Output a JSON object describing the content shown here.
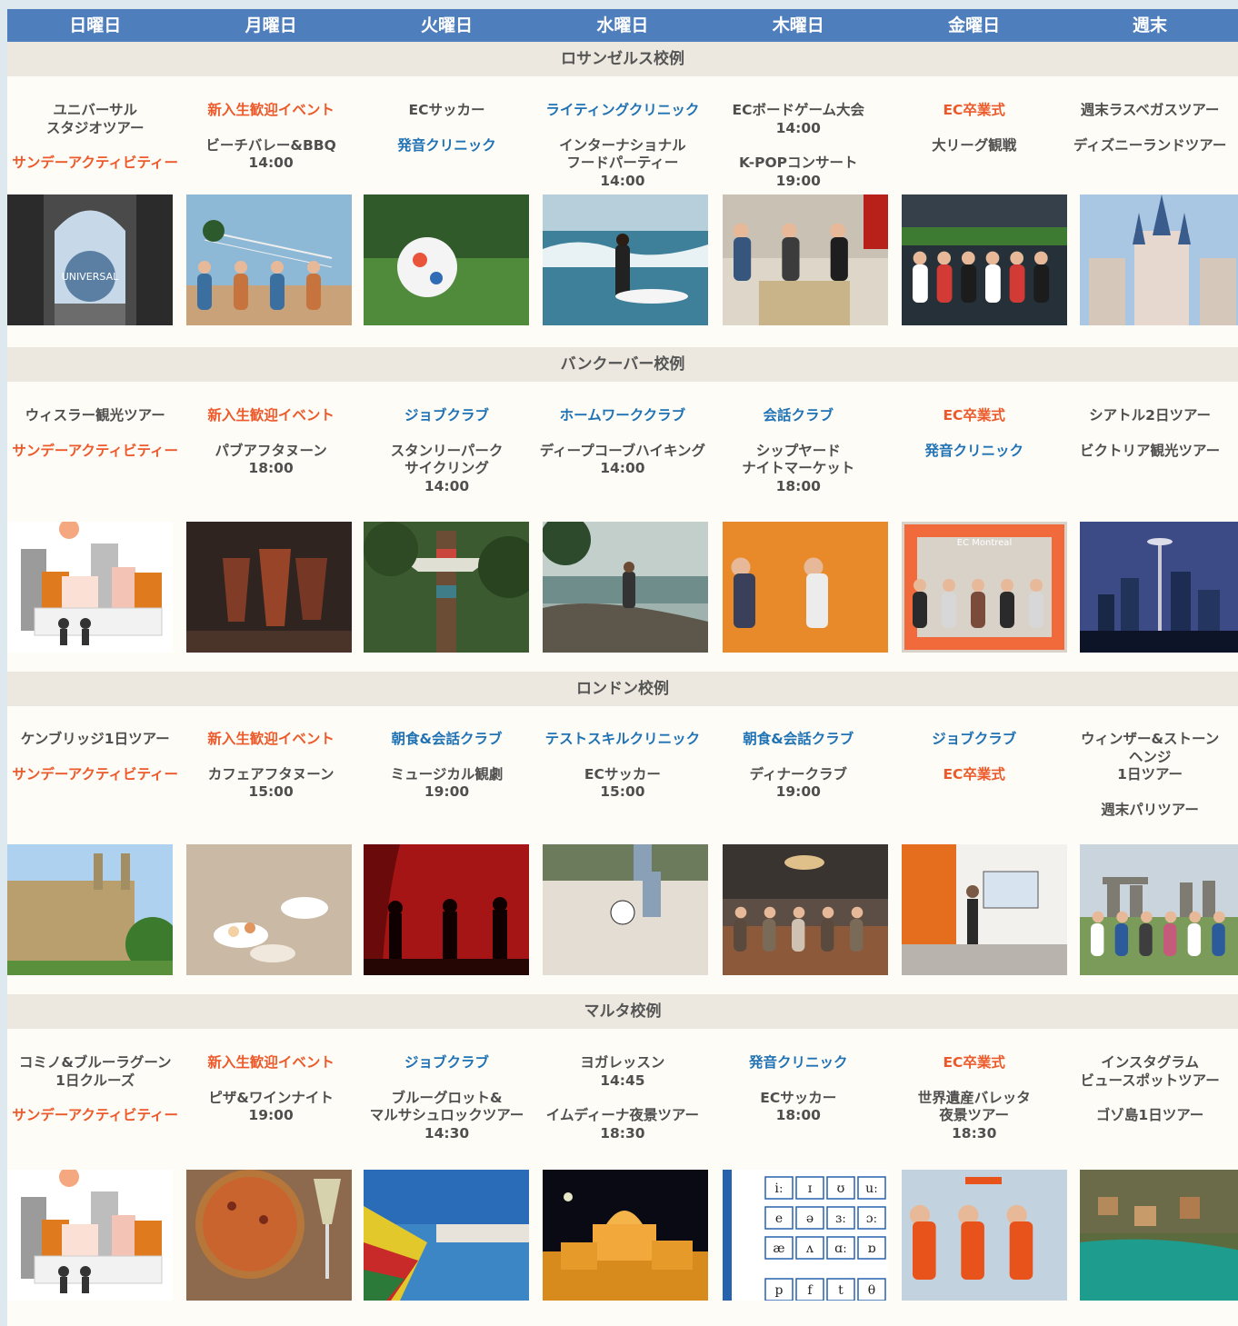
{
  "days": [
    "日曜日",
    "月曜日",
    "火曜日",
    "水曜日",
    "木曜日",
    "金曜日",
    "週末"
  ],
  "campuses": [
    {
      "name": "ロサンゼルス校例",
      "events": [
        [
          {
            "t": "ユニバーサル\nスタジオツアー",
            "c": "n"
          },
          {
            "t": "サンデーアクティビティー",
            "c": "o"
          }
        ],
        [
          {
            "t": "新入生歓迎イベント",
            "c": "o"
          },
          {
            "t": "ビーチバレー&BBQ\n14:00",
            "c": "n"
          }
        ],
        [
          {
            "t": "ECサッカー",
            "c": "n"
          },
          {
            "t": "発音クリニック",
            "c": "b"
          }
        ],
        [
          {
            "t": "ライティングクリニック",
            "c": "b"
          },
          {
            "t": "インターナショナル\nフードパーティー\n14:00",
            "c": "n"
          }
        ],
        [
          {
            "t": "ECボードゲーム大会\n14:00",
            "c": "n"
          },
          {
            "t": "K-POPコンサート\n19:00",
            "c": "n"
          }
        ],
        [
          {
            "t": "EC卒業式",
            "c": "o"
          },
          {
            "t": "大リーグ観戦",
            "c": "n"
          }
        ],
        [
          {
            "t": "週末ラスベガスツアー",
            "c": "n"
          },
          {
            "t": "ディズニーランドツアー",
            "c": "n"
          }
        ]
      ],
      "photos": [
        "Universal Studios archway",
        "Beach volleyball",
        "Soccer ball on grass",
        "Surfer in waves",
        "Board game party",
        "Baseball stadium crowd",
        "Disney castle"
      ]
    },
    {
      "name": "バンクーバー校例",
      "events": [
        [
          {
            "t": "ウィスラー観光ツアー",
            "c": "n"
          },
          {
            "t": "サンデーアクティビティー",
            "c": "o"
          }
        ],
        [
          {
            "t": "新入生歓迎イベント",
            "c": "o"
          },
          {
            "t": "パブアフタヌーン\n18:00",
            "c": "n"
          }
        ],
        [
          {
            "t": "ジョブクラブ",
            "c": "b"
          },
          {
            "t": "スタンリーパーク\nサイクリング\n14:00",
            "c": "n"
          }
        ],
        [
          {
            "t": "ホームワーククラブ",
            "c": "b"
          },
          {
            "t": "ディープコーブハイキング\n14:00",
            "c": "n"
          }
        ],
        [
          {
            "t": "会話クラブ",
            "c": "b"
          },
          {
            "t": "シップヤード\nナイトマーケット\n18:00",
            "c": "n"
          }
        ],
        [
          {
            "t": "EC卒業式",
            "c": "o"
          },
          {
            "t": "発音クリニック",
            "c": "b"
          }
        ],
        [
          {
            "t": "シアトル2日ツアー",
            "c": "n"
          },
          {
            "t": "ビクトリア観光ツアー",
            "c": "n"
          }
        ]
      ],
      "photos": [
        "City illustration",
        "Beer glasses toast",
        "Totem pole",
        "Coastal hiking",
        "Two students smiling",
        "EC Montreal frame",
        "Seattle skyline at night"
      ]
    },
    {
      "name": "ロンドン校例",
      "events": [
        [
          {
            "t": "ケンブリッジ1日ツアー",
            "c": "n"
          },
          {
            "t": "サンデーアクティビティー",
            "c": "o"
          }
        ],
        [
          {
            "t": "新入生歓迎イベント",
            "c": "o"
          },
          {
            "t": "カフェアフタヌーン\n15:00",
            "c": "n"
          }
        ],
        [
          {
            "t": "朝食&会話クラブ",
            "c": "b"
          },
          {
            "t": "ミュージカル観劇\n19:00",
            "c": "n"
          }
        ],
        [
          {
            "t": "テストスキルクリニック",
            "c": "b"
          },
          {
            "t": "ECサッカー\n15:00",
            "c": "n"
          }
        ],
        [
          {
            "t": "朝食&会話クラブ",
            "c": "b"
          },
          {
            "t": "ディナークラブ\n19:00",
            "c": "n"
          }
        ],
        [
          {
            "t": "ジョブクラブ",
            "c": "b"
          },
          {
            "t": "EC卒業式",
            "c": "o"
          }
        ],
        [
          {
            "t": "ウィンザー&ストーン\nヘンジ\n1日ツアー",
            "c": "n"
          },
          {
            "t": "週末パリツアー",
            "c": "n"
          }
        ]
      ],
      "photos": [
        "Cambridge college",
        "Afternoon tea",
        "Theatre stage silhouettes",
        "Beach soccer",
        "Dinner club restaurant",
        "Classroom presentation",
        "Stonehenge group"
      ]
    },
    {
      "name": "マルタ校例",
      "events": [
        [
          {
            "t": "コミノ&ブルーラグーン\n1日クルーズ",
            "c": "n"
          },
          {
            "t": "サンデーアクティビティー",
            "c": "o"
          }
        ],
        [
          {
            "t": "新入生歓迎イベント",
            "c": "o"
          },
          {
            "t": "ピザ&ワインナイト\n19:00",
            "c": "n"
          }
        ],
        [
          {
            "t": "ジョブクラブ",
            "c": "b"
          },
          {
            "t": "ブルーグロット&\nマルサシュロックツアー\n14:30",
            "c": "n"
          }
        ],
        [
          {
            "t": "ヨガレッスン\n14:45",
            "c": "n"
          },
          {
            "t": "イムディーナ夜景ツアー\n18:30",
            "c": "n"
          }
        ],
        [
          {
            "t": "発音クリニック",
            "c": "b"
          },
          {
            "t": "ECサッカー\n18:00",
            "c": "n"
          }
        ],
        [
          {
            "t": "EC卒業式",
            "c": "o"
          },
          {
            "t": "世界遺産バレッタ\n夜景ツアー\n18:30",
            "c": "n"
          }
        ],
        [
          {
            "t": "インスタグラム\nビュースポットツアー",
            "c": "n"
          },
          {
            "t": "ゴゾ島1日ツアー",
            "c": "n"
          }
        ]
      ],
      "photos": [
        "City illustration",
        "Pizza and wine",
        "Colorful Maltese boat",
        "Mdina at night",
        "Phonetic chart",
        "Graduation students",
        "Popeye village bay"
      ]
    }
  ],
  "phonetic_symbols": [
    "iː",
    "ɪ",
    "ʊ",
    "uː",
    "e",
    "ə",
    "ɜː",
    "ɔː",
    "æ",
    "ʌ",
    "ɑː",
    "ɒ",
    "p",
    "f",
    "t",
    "θ"
  ],
  "logo_text": {
    "universal": "UNIVERSAL",
    "montreal_frame": "EC Montreal"
  },
  "colors": {
    "header_bg": "#4f7ebd",
    "band_bg": "#ece8df",
    "orange": "#ec5a2b",
    "blue": "#1f72b4",
    "text": "#4f4f4f",
    "page_bg": "#fefcf6"
  }
}
